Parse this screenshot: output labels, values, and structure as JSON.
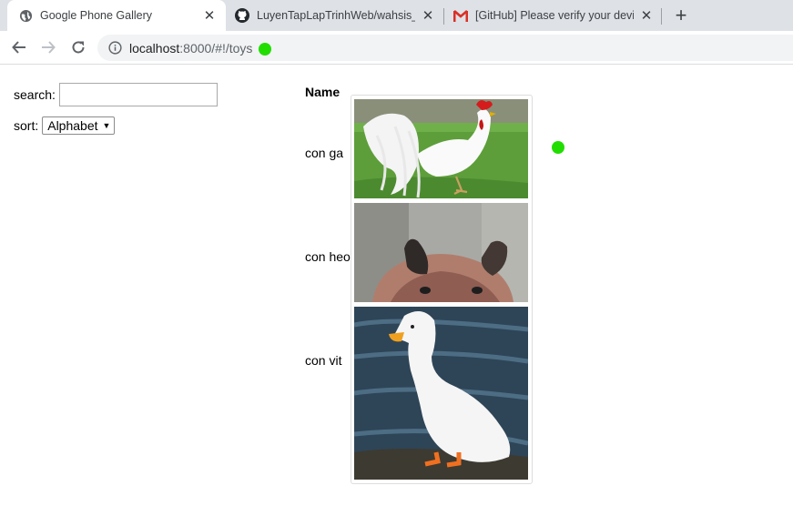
{
  "browser": {
    "tabs": [
      {
        "title": "Google Phone Gallery",
        "icon": "globe-icon",
        "active": true
      },
      {
        "title": "LuyenTapLapTrinhWeb/wahsis_dc",
        "icon": "github-icon",
        "active": false
      },
      {
        "title": "[GitHub] Please verify your device",
        "icon": "gmail-icon",
        "active": false
      }
    ],
    "address": {
      "host": "localhost",
      "path": ":8000/#!/toys"
    },
    "status_dot_color": "#22dd00"
  },
  "controls": {
    "search_label": "search:",
    "search_value": "",
    "sort_label": "sort:",
    "sort_value": "Alphabet"
  },
  "list": {
    "header": "Name",
    "items": [
      {
        "name": "con ga",
        "image": "white-rooster-photo"
      },
      {
        "name": "con heo",
        "image": "pig-head-photo"
      },
      {
        "name": "con vit",
        "image": "white-duck-photo"
      }
    ]
  }
}
